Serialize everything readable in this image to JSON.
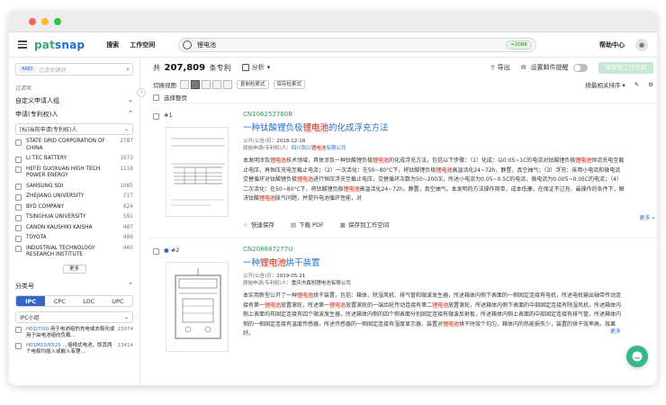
{
  "nav": {
    "logo_part1": "pat",
    "logo_part2": "snap",
    "links": [
      "搜索",
      "工作空间"
    ],
    "search_value": "锂电池",
    "result_pill": "≈208K",
    "help": "帮助中心"
  },
  "sidebar": {
    "and_tag": "AND",
    "filter_placeholder": "过滤关键词",
    "filter_label": "过滤项",
    "custom_applicant": "自定义申请人组",
    "applicant_section": "申请(专利权)人",
    "applicant_select": "[标]当前申请(专利权)人",
    "applicants": [
      {
        "name": "STATE GRID CORPORATION OF CHINA",
        "count": "2787"
      },
      {
        "name": "LI TEC BATTERY",
        "count": "1673"
      },
      {
        "name": "HEFEI GUOXUAN HIGH TECH POWER ENERGY",
        "count": "1118"
      },
      {
        "name": "SAMSUNG SDI",
        "count": "1085"
      },
      {
        "name": "ZHEJIANG UNIVERSITY",
        "count": "717"
      },
      {
        "name": "BYD COMPANY",
        "count": "624"
      },
      {
        "name": "TSINGHUA UNIVERSITY",
        "count": "591"
      },
      {
        "name": "CANON KAUSHIKI KAISHA",
        "count": "487"
      },
      {
        "name": "TOYOTA",
        "count": "486"
      },
      {
        "name": "INDUSTRIAL TECHNOLOGY RESEARCH INSTITUTE",
        "count": "460"
      }
    ],
    "more": "更多",
    "class_section": "分类号",
    "class_tabs": [
      "IPC",
      "CPC",
      "LOC",
      "UPC"
    ],
    "ipc_select": "IPC小组",
    "ipc_items": [
      {
        "code": "H02J7/00",
        "text": "用于电池组的充电或去极化或用于由电池组向负载...",
        "count": "15974"
      },
      {
        "code": "H01M10/0525",
        "text": "…摇椅式电池，即其两个电极均插入或嵌入有锂...",
        "count": "13414"
      }
    ]
  },
  "main": {
    "total_prefix": "共",
    "total_count": "207,809",
    "total_suffix": "条专利",
    "analysis": "分析",
    "export": "导出",
    "alert": "设置邮件提醒",
    "save_workspace": "保存到工作空间",
    "switch_view": "切换视图",
    "copy_query": "复制检索式",
    "save_query": "保存检索式",
    "sort": "按最相关排序",
    "select_page": "选择整页"
  },
  "results": [
    {
      "index": "#1",
      "pn": "CN106252760B",
      "title": "一种钛酸锂负极锂电池的化成浮充方法",
      "pubdate_label": "公开(公告)日：",
      "pubdate": "2018-12-18",
      "applicant_label": "原始申请(专利权)人：",
      "applicant": "四川剑兴锂电池有限公司",
      "abstract": "本发明涉及锂电池技术领域，具体涉及一种钛酸锂负极锂电池的化成浮充方法，包括以下步骤：（1）化成：以0.05~1C的电流对钛酸锂负极锂电池恒流充电至截止电压，再恒压充电至截止电流；（2）一次活化：在50~80°C下，将钛酸锂负极锂电池高温活化24~72h，静置，真空抽气；（3）浮充：采用小电流和微电流交替循环对钛酸锂负极锂电池进行恒压浮充至截止电压，交替循环次数为50~200次，所述小电流为0.05~0.5C的电流，微电流为0.005~0.05C的电流；（4）二次活化：在50~80°C下，将钛酸锂负极锂电池高温活化24~72h，静置，真空抽气。本发明的方法操作简单，成本低廉，在保证不过充、最操作的条件下，解决钛酸锂电池胀气问题，并提升电池循环性能，对",
      "actions": [
        "快速保存",
        "下载 PDF",
        "保存到工作空间"
      ],
      "more": "更多"
    },
    {
      "index": "#2",
      "pn": "CN208887277U",
      "title": "一种锂电池烘干装置",
      "pubdate_label": "公开(公告)日：",
      "pubdate": "2019-05-21",
      "applicant_label": "原始申请(专利权)人：",
      "applicant": "重庆市鑫旭锂电池有限公司",
      "abstract": "本实用新型公开了一种锂电池烘干装置，包括：箱体、除湿风机、排气管和微波发生器，所述箱体内侧下表面的一侧固定连接有电机，所述电机输出轴带传动连接有第一锂电池放置滚轮，所述第一锂电池放置滚轮的一端齿轮传动连接有第二锂电池放置滚轮，所述箱体内侧下表面的中部固定连接有除湿风机，所述箱体内侧上表面均布固定连接有四个微波发生器，所述箱体内侧的四个侧表面分别固定连接有微波反射板，所述箱体内侧上表面的中部固定连接有排气管，所述箱体内侧的一侧固定连接有温度传感器，所述传感器的一侧固定连接有湿度显示器，装置对锂电池烘干时效个均匀，箱体内的热能损失少，装置的烘干效率高，效果好。",
      "more": "更多"
    }
  ],
  "colors": {
    "brand_green": "#3aa57a",
    "brand_blue": "#1f6fd1",
    "highlight": "#c0392b"
  }
}
